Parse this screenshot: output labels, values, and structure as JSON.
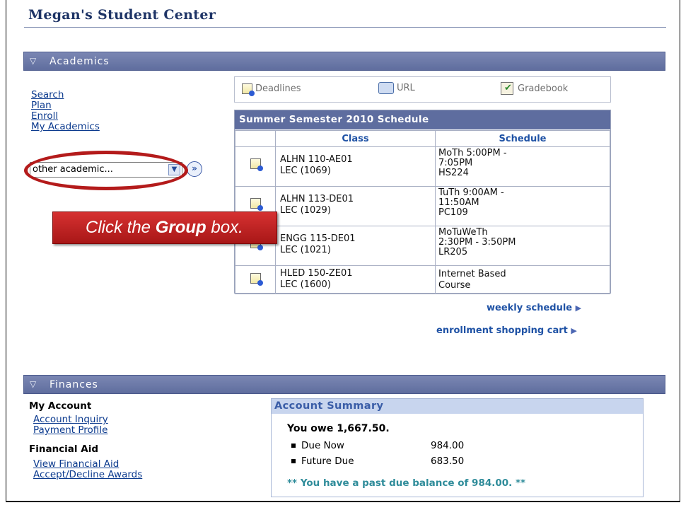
{
  "page": {
    "title": "Megan's Student Center"
  },
  "academics": {
    "section_label": "Academics",
    "links": [
      "Search",
      "Plan",
      "Enroll",
      "My Academics"
    ],
    "select_value": "other academic...",
    "tools": {
      "deadlines": "Deadlines",
      "url": "URL",
      "gradebook": "Gradebook"
    },
    "schedule": {
      "title": "Summer Semester 2010 Schedule",
      "col_class": "Class",
      "col_schedule": "Schedule",
      "rows": [
        {
          "c1": "ALHN 110-AE01",
          "c2": "LEC (1069)",
          "s1": "MoTh 5:00PM -",
          "s2": "7:05PM",
          "s3": "HS224"
        },
        {
          "c1": "ALHN 113-DE01",
          "c2": "LEC (1029)",
          "s1": "TuTh 9:00AM -",
          "s2": "11:50AM",
          "s3": "PC109"
        },
        {
          "c1": "ENGG 115-DE01",
          "c2": "LEC (1021)",
          "s1": "MoTuWeTh",
          "s2": "2:30PM - 3:50PM",
          "s3": "LR205"
        },
        {
          "c1": "HLED 150-ZE01",
          "c2": "LEC (1600)",
          "s1": "Internet Based",
          "s2": "Course",
          "s3": ""
        }
      ]
    },
    "weekly_link": "weekly schedule",
    "cart_link": "enrollment shopping cart"
  },
  "callout": {
    "prefix": "Click the ",
    "emph": "Group",
    "suffix": " box."
  },
  "finances": {
    "section_label": "Finances",
    "my_account": "My Account",
    "account_inquiry": "Account Inquiry",
    "payment_profile": "Payment Profile",
    "financial_aid": "Financial Aid",
    "view_financial_aid": "View Financial Aid",
    "accept_decline": "Accept/Decline Awards",
    "summary": {
      "title": "Account Summary",
      "owe": "You owe 1,667.50.",
      "due_now_label": "Due Now",
      "due_now_value": "984.00",
      "future_label": "Future Due",
      "future_value": "683.50",
      "past_due": "** You have a past due balance of 984.00. **"
    }
  }
}
